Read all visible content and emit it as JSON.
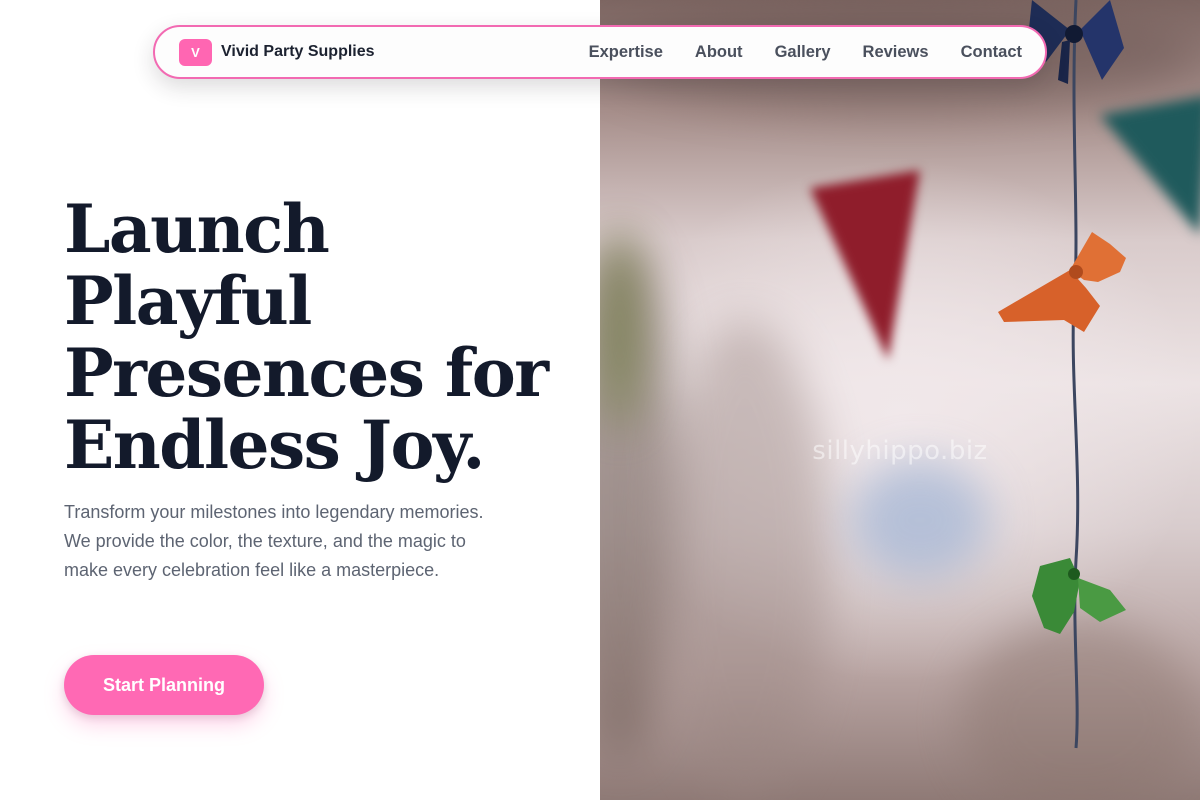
{
  "nav": {
    "brand_initial": "V",
    "brand_name": "Vivid Party Supplies",
    "links": [
      "Expertise",
      "About",
      "Gallery",
      "Reviews",
      "Contact"
    ]
  },
  "hero": {
    "title_lines": [
      "Launch",
      "Playful",
      "Presences for",
      "Endless Joy."
    ],
    "subtitle": "Transform your milestones into legendary memories. We provide the color, the texture, and the magic to make every celebration feel like a masterpiece.",
    "cta_label": "Start Planning"
  },
  "image": {
    "watermark": "sillyhippo.biz"
  },
  "colors": {
    "accent": "#ff69b4",
    "nav_border": "#f26ab2",
    "heading": "#131a2b",
    "body_text": "#5d6472",
    "nav_text": "#4a505d"
  }
}
